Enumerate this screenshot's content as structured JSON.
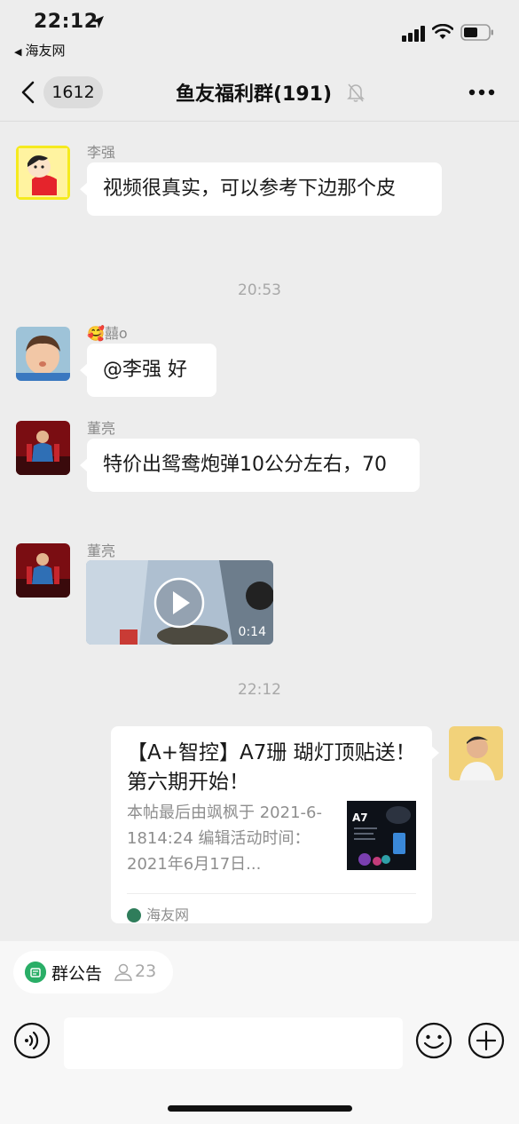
{
  "status_bar": {
    "time": "22:12",
    "back_app": "海友网"
  },
  "nav": {
    "unread_count": "1612",
    "title": "鱼友福利群(191)"
  },
  "messages": [
    {
      "sender": "李强",
      "text": "视频很真实，可以参考下边那个皮"
    },
    {
      "timestamp": "20:53"
    },
    {
      "sender": "🥰囍o",
      "text": "@李强 好"
    },
    {
      "sender": "董亮",
      "text": "特价出鸳鸯炮弹10公分左右，70"
    },
    {
      "sender": "董亮",
      "video_duration": "0:14"
    },
    {
      "timestamp": "22:12"
    },
    {
      "link_card": {
        "title": "【A+智控】A7珊 瑚灯顶贴送！第六期开始！",
        "desc": "本帖最后由飒枫于 2021-6-1814:24 编辑活动时间：2021年6月17日...",
        "thumb_label": "A7",
        "source": "海友网"
      }
    }
  ],
  "bottom": {
    "notice_label": "群公告",
    "notice_count": "23"
  },
  "colors": {
    "background": "#ededed",
    "bubble": "#ffffff",
    "notice_green": "#2aae67",
    "meta_text": "#a8a8a8"
  },
  "icons": [
    "location-arrow-icon",
    "signal-icon",
    "wifi-icon",
    "battery-icon",
    "back-chevron-icon",
    "mute-bell-icon",
    "more-icon",
    "play-icon",
    "site-logo-icon",
    "notice-icon",
    "person-icon",
    "voice-icon",
    "emoji-icon",
    "plus-icon"
  ]
}
